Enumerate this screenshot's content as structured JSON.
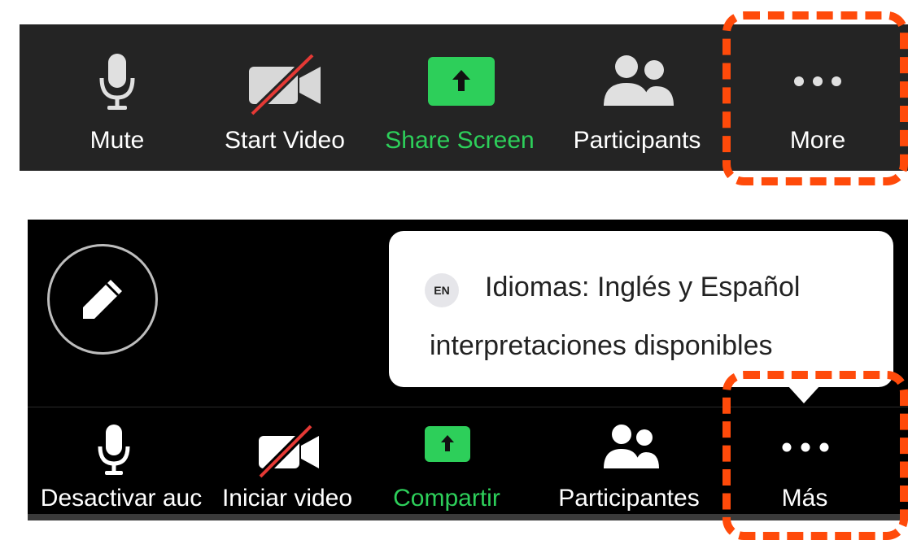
{
  "toolbar_en": {
    "mute_label": "Mute",
    "start_video_label": "Start Video",
    "share_screen_label": "Share Screen",
    "participants_label": "Participants",
    "more_label": "More"
  },
  "toolbar_es": {
    "mute_label": "Desactivar auc",
    "video_label": "Iniciar video",
    "share_label": "Compartir",
    "participants_label": "Participantes",
    "more_label": "Más"
  },
  "tooltip": {
    "badge": "EN",
    "line1": "Idiomas: Inglés y Español",
    "line2": "interpretaciones disponibles"
  },
  "colors": {
    "toolbar_bg": "#242424",
    "share_green": "#2dcf5a",
    "highlight_orange": "#ff4a0a",
    "video_slash_red": "#e53935"
  },
  "icons": {
    "mute": "microphone-icon",
    "video": "video-off-icon",
    "share": "share-screen-up-arrow-icon",
    "participants": "participants-icon",
    "more": "more-dots-icon",
    "annotate": "pencil-icon",
    "language": "language-badge-icon"
  }
}
